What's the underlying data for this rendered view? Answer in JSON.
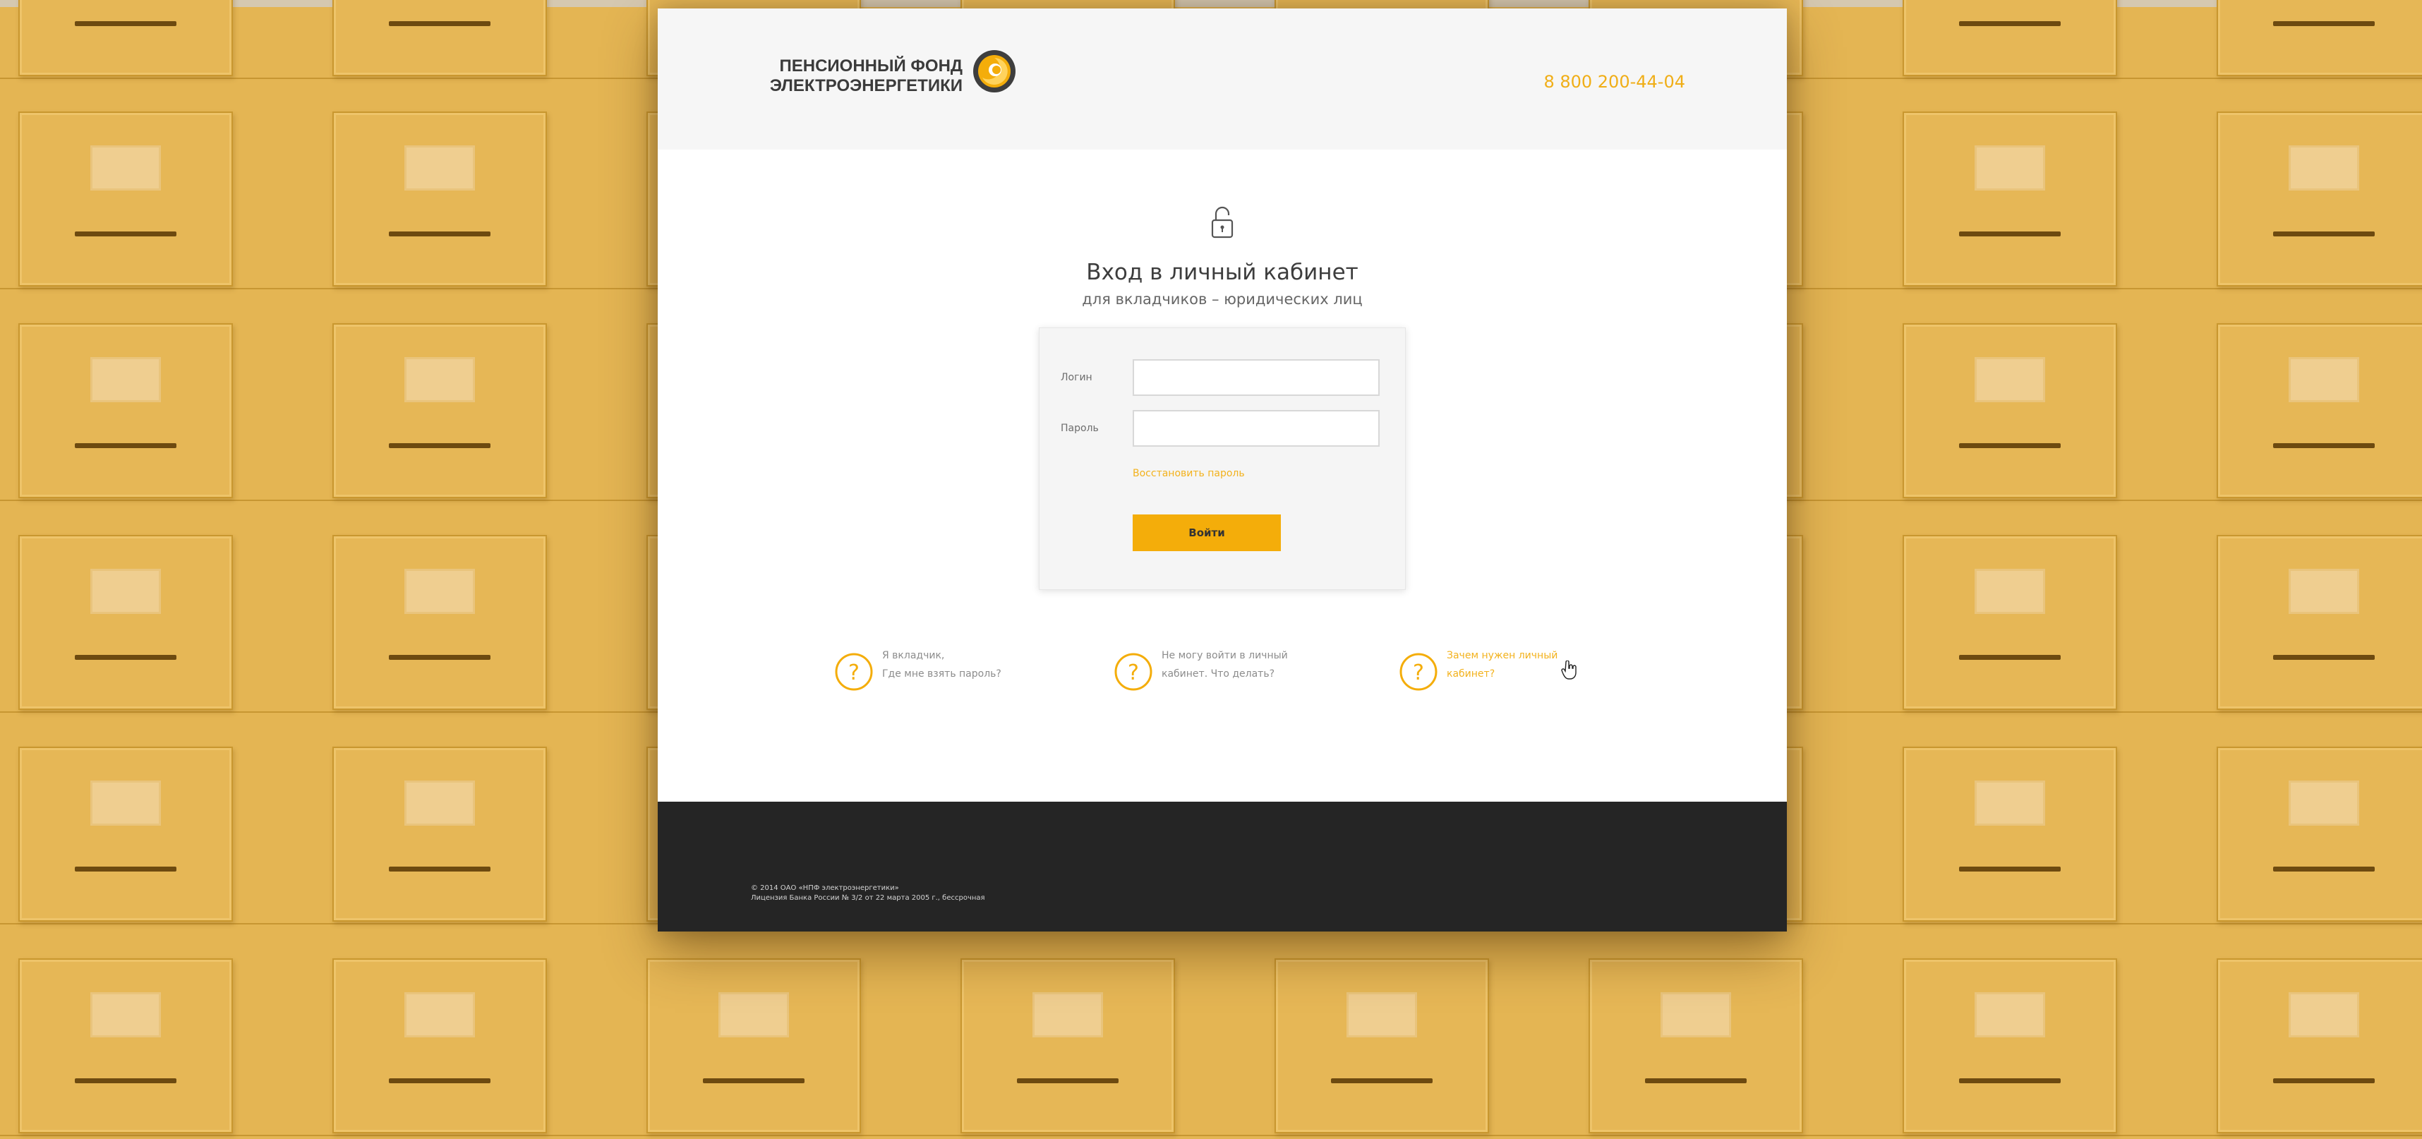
{
  "colors": {
    "accent": "#f4ad0a",
    "phone": "#f0ae17",
    "cabinet": "#e4b553",
    "footer_bg": "#252525"
  },
  "header": {
    "logo_line1": "ПЕНСИОННЫЙ ФОНД",
    "logo_line2": "ЭЛЕКТРОЭНЕРГЕТИКИ",
    "logo_icon": "fund-logo-icon",
    "phone": "8 800 200-44-04"
  },
  "login": {
    "icon": "unlocked-padlock-icon",
    "title": "Вход в личный кабинет",
    "subtitle": "для вкладчиков – юридических лиц",
    "login_label": "Логин",
    "login_value": "",
    "password_label": "Пароль",
    "password_value": "",
    "restore_link": "Восстановить пароль",
    "submit_label": "Войти"
  },
  "faq": [
    {
      "icon": "question-icon",
      "line1": "Я вкладчик,",
      "line2": "Где мне взять пароль?"
    },
    {
      "icon": "question-icon",
      "line1": "Не могу войти в личный",
      "line2": "кабинет. Что делать?"
    },
    {
      "icon": "question-icon",
      "line1": "Зачем нужен личный",
      "line2": "кабинет?"
    }
  ],
  "footer": {
    "copyright": "© 2014 ОАО «НПФ электроэнергетики»",
    "license": "Лицензия Банка России № 3/2 от 22 марта 2005 г., бессрочная"
  }
}
